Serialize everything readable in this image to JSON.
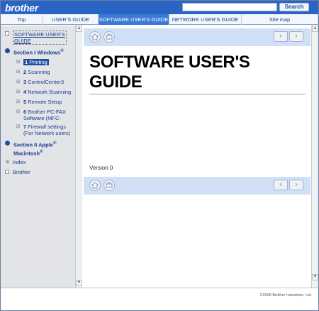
{
  "header": {
    "logo": "brother",
    "search_placeholder": "",
    "search_button": "Search"
  },
  "tabs": [
    {
      "label": "Top"
    },
    {
      "label": "USER'S GUIDE"
    },
    {
      "label": "SOFTWARE USER'S GUIDE"
    },
    {
      "label": "NETWORK USER'S GUIDE"
    },
    {
      "label": "Site map"
    }
  ],
  "sidebar": {
    "root_label": "SOFTWARE USER'S GUIDE",
    "section1": "Section I Windows",
    "section1_sup": "®",
    "items": [
      {
        "num": "1",
        "label": "Printing"
      },
      {
        "num": "2",
        "label": "Scanning"
      },
      {
        "num": "3",
        "label": "ControlCenter3"
      },
      {
        "num": "4",
        "label": "Network Scanning"
      },
      {
        "num": "5",
        "label": "Remote Setup"
      },
      {
        "num": "6",
        "label": "Brother PC-FAX Software (MFC-"
      },
      {
        "num": "7",
        "label": "Firewall settings (For Network users)"
      }
    ],
    "section2_a": "Section II Apple",
    "section2_b": "Macintosh",
    "section2_sup": "®",
    "index": "Index",
    "brother": "Brother"
  },
  "content": {
    "title_line1": "SOFTWARE USER'S",
    "title_line2": "GUIDE",
    "version": "Version 0"
  },
  "footer": {
    "copyright": "©2008 Brother Industries, Ltd."
  },
  "colors": {
    "header_blue": "#2a64c5",
    "tab_active": "#3b7ad6",
    "band": "#cfe0f7",
    "sidebar": "#e2e4e7",
    "link": "#1b3f8f"
  },
  "icons": [
    "home-icon",
    "print-icon",
    "prev-arrow-icon",
    "next-arrow-icon"
  ]
}
